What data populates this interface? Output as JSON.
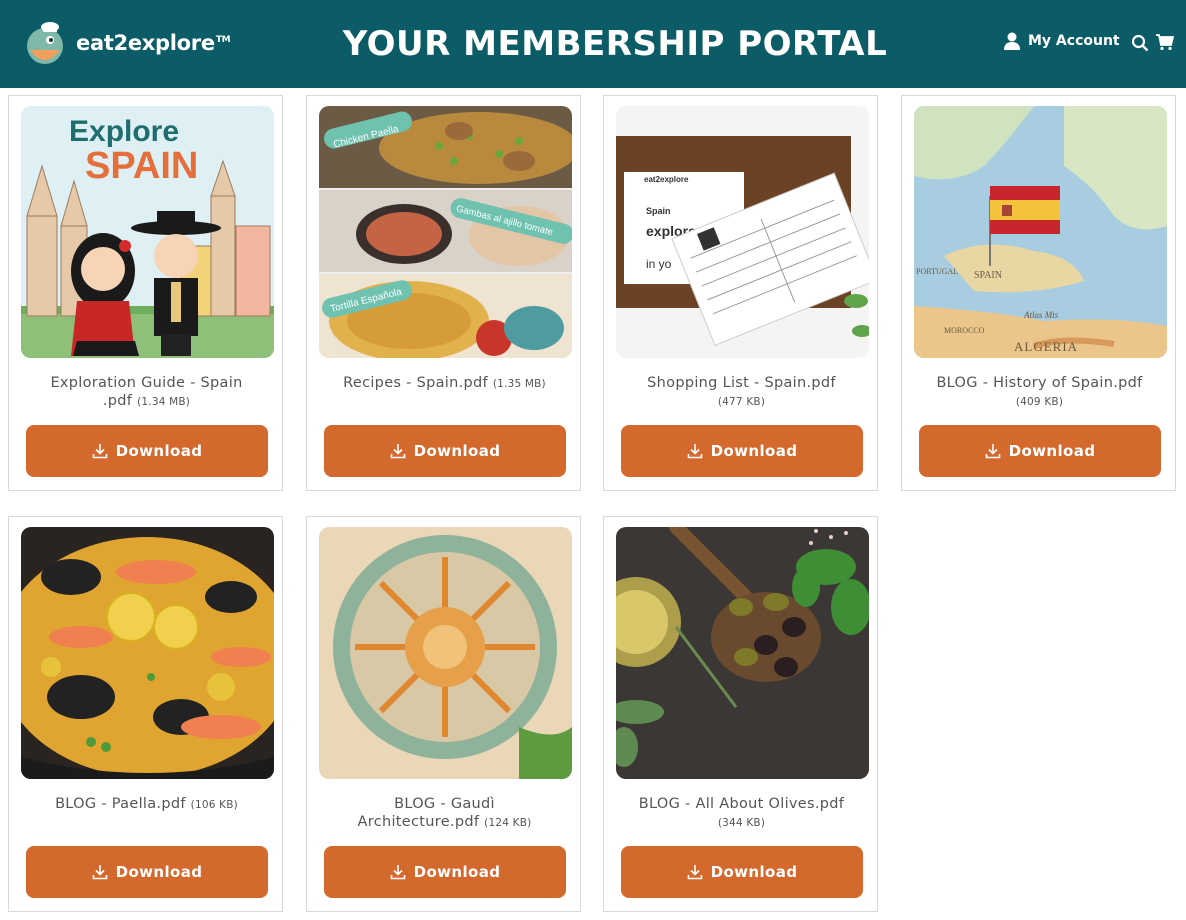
{
  "header": {
    "brand": "eat2explore",
    "brand_tm": "TM",
    "title": "YOUR MEMBERSHIP PORTAL",
    "account_label": "My Account",
    "bg_color": "#0b5c66"
  },
  "accent_color": "#d4692e",
  "download_label": "Download",
  "cards": [
    {
      "title_line1": "Exploration Guide - Spain",
      "title_line2": ".pdf",
      "size": "(1.34 MB)",
      "image": "explore-spain-illustration"
    },
    {
      "title_line1": "Recipes - Spain.pdf",
      "title_line2": "",
      "size": "(1.35 MB)",
      "image": "spanish-dishes-collage",
      "image_labels": [
        "Chicken Paella",
        "Gambas al ajillo tomate",
        "Tortilla Española"
      ]
    },
    {
      "title_line1": "Shopping List - Spain.pdf",
      "title_line2": "",
      "size": "(477 KB)",
      "image": "shopping-list-photo",
      "image_labels": [
        "eat2explore",
        "Spain",
        "explore",
        "in yo"
      ]
    },
    {
      "title_line1": "BLOG - History of Spain.pdf",
      "title_line2": "",
      "size": "(409 KB)",
      "image": "map-with-spain-flag",
      "image_labels": [
        "SPAIN",
        "ALGERIA",
        "PORTUGAL",
        "MOROCCO",
        "Atlas Mts"
      ]
    },
    {
      "title_line1": "BLOG - Paella.pdf",
      "title_line2": "",
      "size": "(106 KB)",
      "image": "seafood-paella-photo"
    },
    {
      "title_line1": "BLOG - Gaudì",
      "title_line2": "Architecture.pdf",
      "size": "(124 KB)",
      "image": "gaudi-mosaic-photo"
    },
    {
      "title_line1": "BLOG - All About Olives.pdf",
      "title_line2": "",
      "size": "(344 KB)",
      "image": "olives-and-oil-photo"
    }
  ]
}
